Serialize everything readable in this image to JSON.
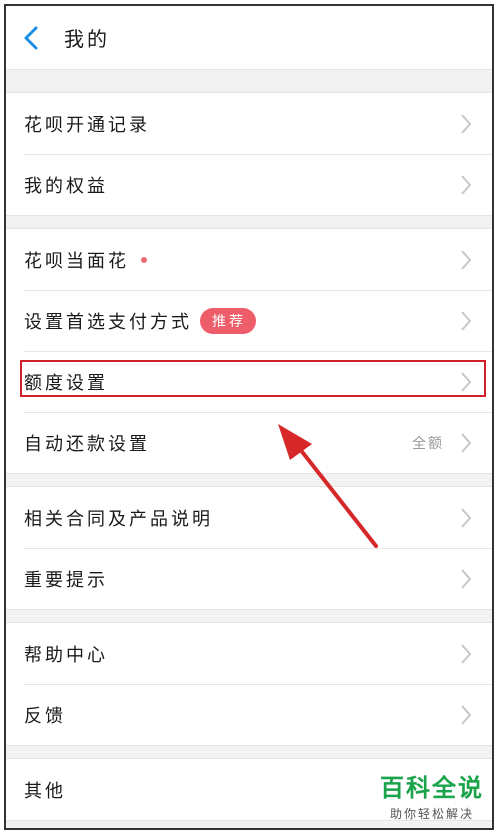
{
  "header": {
    "title": "我的"
  },
  "groups": [
    {
      "items": [
        {
          "label": "花呗开通记录"
        },
        {
          "label": "我的权益"
        }
      ]
    },
    {
      "items": [
        {
          "label": "花呗当面花"
        },
        {
          "label": "设置首选支付方式",
          "badge": "推荐"
        },
        {
          "label": "额度设置"
        },
        {
          "label": "自动还款设置",
          "value": "全额"
        }
      ]
    },
    {
      "items": [
        {
          "label": "相关合同及产品说明"
        },
        {
          "label": "重要提示"
        }
      ]
    },
    {
      "items": [
        {
          "label": "帮助中心"
        },
        {
          "label": "反馈"
        }
      ]
    },
    {
      "items": [
        {
          "label": "其他"
        }
      ]
    }
  ],
  "watermark": {
    "main": "百科全说",
    "sub": "助你轻松解决"
  },
  "colors": {
    "accent": "#1a8ee6",
    "badge": "#ee5d6a",
    "highlight": "#d1202b",
    "watermark": "#1aa34a"
  },
  "icons": {
    "back": "chevron-left-icon",
    "row": "chevron-right-icon"
  }
}
